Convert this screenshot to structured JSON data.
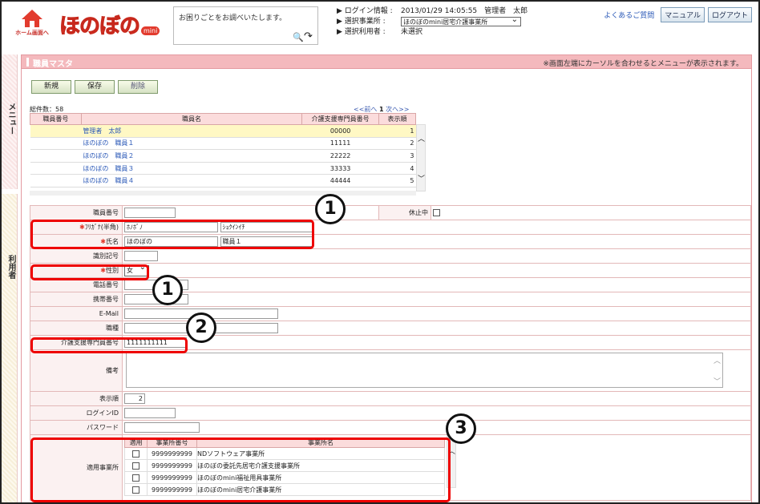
{
  "header": {
    "home_label": "ホーム画面へ",
    "logo_text": "ほのぼの",
    "logo_mini": "mini",
    "search_placeholder": "お困りごとをお調べいたします。",
    "login_label": "ログイン情報",
    "login_value": "2013/01/29 14:05:55　管理者　太郎",
    "office_label": "選択事業所",
    "office_value": "ほのぼのmini居宅介護事業所",
    "user_label": "選択利用者",
    "user_value": "未選択",
    "faq": "よくあるご質問",
    "manual": "マニュアル",
    "logout": "ログアウト"
  },
  "sidebar": {
    "menu_tab": "メニュー",
    "user_tab": "利用者"
  },
  "title": {
    "text": "職員マスタ",
    "note": "※画面左端にカーソルを合わせるとメニューが表示されます。"
  },
  "actions": {
    "new": "新規",
    "save": "保存",
    "delete": "削除"
  },
  "list": {
    "total": "総件数：58",
    "pager_prev": "<<前へ",
    "pager_page": "1",
    "pager_next": "次へ>>",
    "columns": [
      "職員番号",
      "職員名",
      "介護支援専門員番号",
      "表示順"
    ],
    "rows": [
      {
        "id": "",
        "name": "管理者　太郎",
        "care_no": "00000",
        "order": "1"
      },
      {
        "id": "",
        "name": "ほのぼの　職員１",
        "care_no": "11111",
        "order": "2"
      },
      {
        "id": "",
        "name": "ほのぼの　職員２",
        "care_no": "22222",
        "order": "3"
      },
      {
        "id": "",
        "name": "ほのぼの　職員３",
        "care_no": "33333",
        "order": "4"
      },
      {
        "id": "",
        "name": "ほのぼの　職員４",
        "care_no": "44444",
        "order": "5"
      }
    ]
  },
  "form": {
    "staff_no_label": "職員番号",
    "suspend_label": "休止中",
    "kana_label": "ﾌﾘｶﾞﾅ(半角)",
    "kana_last": "ﾎﾉﾎﾞﾉ",
    "kana_first": "ｼｮｸｲﾝｲﾁ",
    "name_label": "氏名",
    "name_last": "ほのぼの",
    "name_first": "職員１",
    "ident_label": "識別記号",
    "gender_label": "性別",
    "gender_value": "女",
    "phone_label": "電話番号",
    "mobile_label": "携帯番号",
    "email_label": "E-Mail",
    "job_label": "職種",
    "care_no_label": "介護支援専門員番号",
    "care_no_value": "1111111111",
    "remarks_label": "備考",
    "order_label": "表示順",
    "order_value": "2",
    "login_id_label": "ログインID",
    "password_label": "パスワード",
    "office_label": "適用事業所",
    "office_columns": [
      "適用",
      "事業所番号",
      "事業所名"
    ],
    "offices": [
      {
        "no": "9999999999",
        "name": "NDソフトウェア事業所"
      },
      {
        "no": "9999999999",
        "name": "ほのぼの委託先居宅介護支援事業所"
      },
      {
        "no": "9999999999",
        "name": "ほのぼのmini福祉用具事業所"
      },
      {
        "no": "9999999999",
        "name": "ほのぼのmini居宅介護事業所"
      }
    ]
  },
  "callouts": [
    "1",
    "1",
    "2",
    "3"
  ]
}
